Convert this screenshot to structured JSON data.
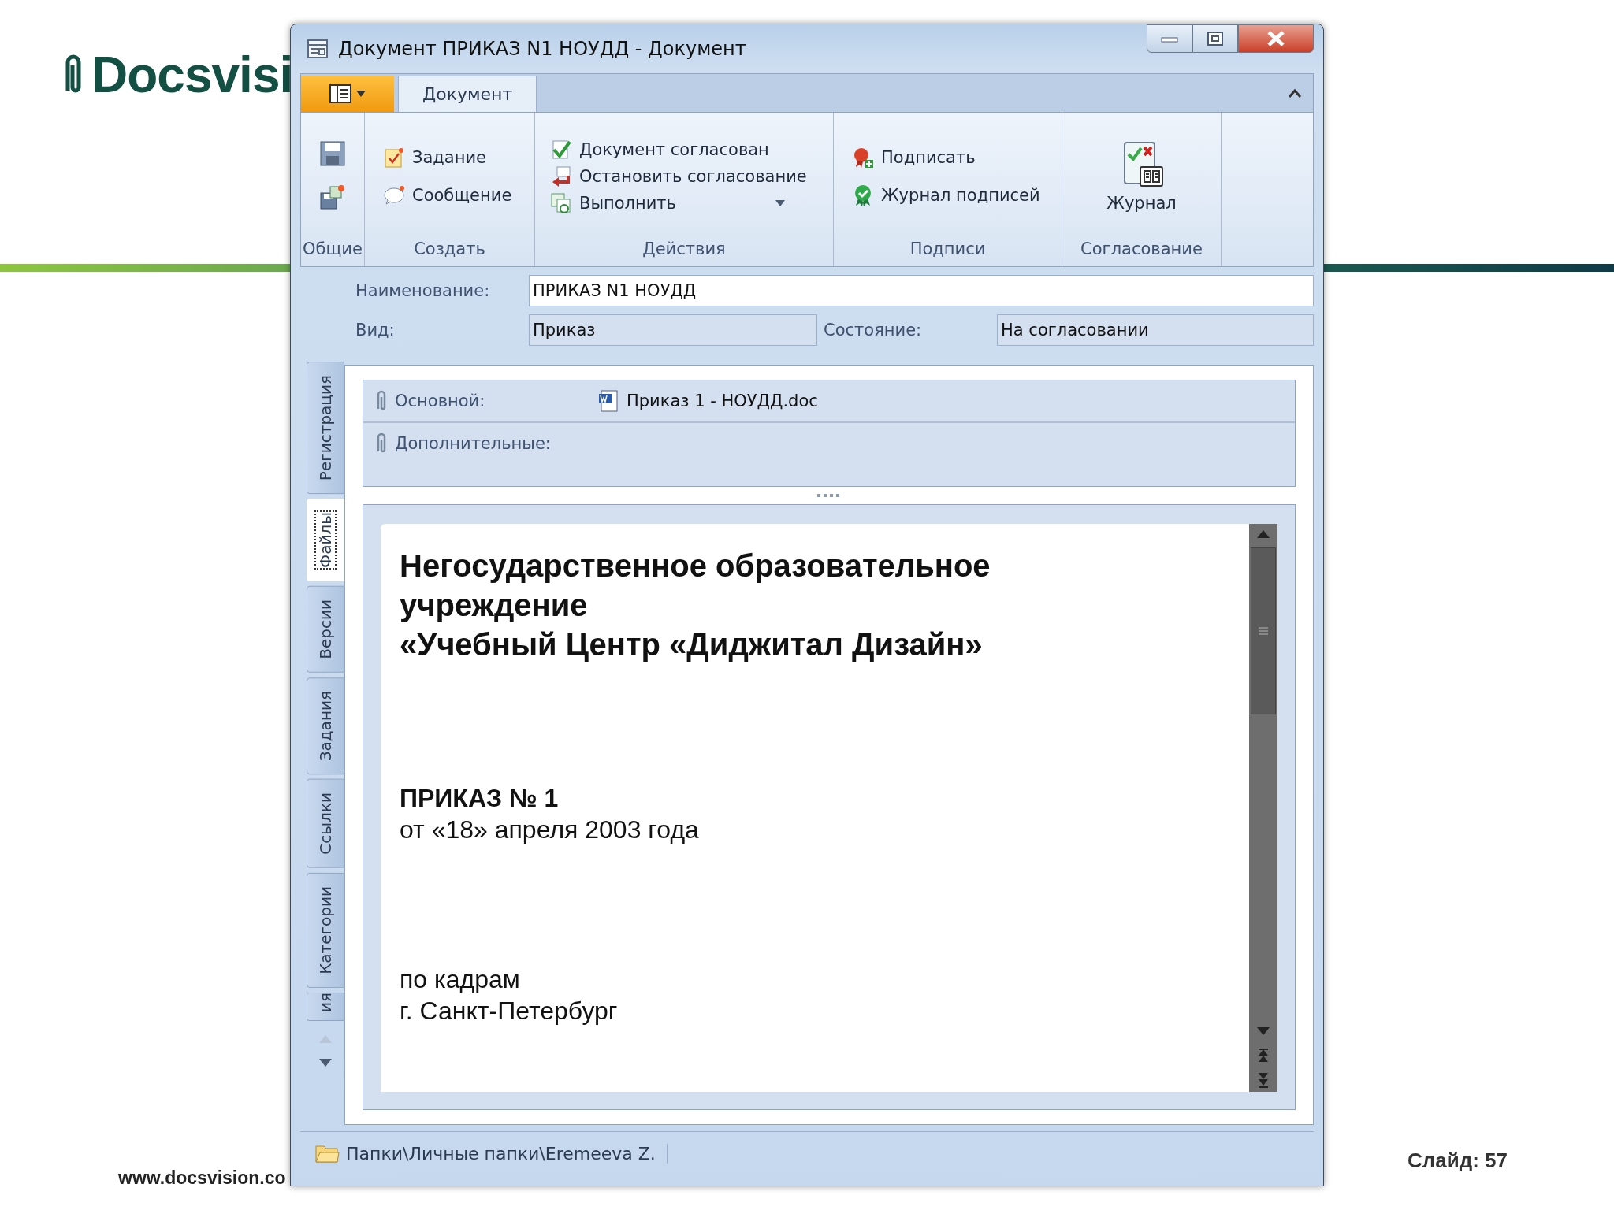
{
  "slide": {
    "logo_text": "Docsvisi",
    "website": "www.docsvision.co",
    "slide_number": "Слайд: 57"
  },
  "window": {
    "title": "Документ ПРИКАЗ N1 НОУДД - Документ"
  },
  "ribbon": {
    "tabs": [
      {
        "label": "Документ",
        "selected": true
      }
    ],
    "groups": [
      {
        "label": "Общие"
      },
      {
        "label": "Создать",
        "items": [
          {
            "label": "Задание",
            "kind": "small",
            "dropdown": false
          },
          {
            "label": "Сообщение",
            "kind": "small",
            "dropdown": false
          }
        ]
      },
      {
        "label": "Действия",
        "items": [
          {
            "label": "Документ согласован",
            "kind": "compact",
            "dropdown": false
          },
          {
            "label": "Остановить согласование",
            "kind": "compact",
            "dropdown": false
          },
          {
            "label": "Выполнить",
            "kind": "compact",
            "dropdown": true
          }
        ]
      },
      {
        "label": "Подписи",
        "items": [
          {
            "label": "Подписать",
            "kind": "small",
            "dropdown": false
          },
          {
            "label": "Журнал подписей",
            "kind": "small",
            "dropdown": false
          }
        ]
      },
      {
        "label": "Согласование",
        "items": [
          {
            "label": "Журнал",
            "kind": "large",
            "dropdown": false
          }
        ]
      }
    ]
  },
  "fields": [
    {
      "label": "Наименование:",
      "value": "ПРИКАЗ N1 НОУДД",
      "readonly": false
    },
    {
      "label": "Вид:",
      "value": "Приказ",
      "readonly": true
    },
    {
      "label": "Состояние:",
      "value": "На согласовании",
      "readonly": true
    }
  ],
  "side_tabs": [
    {
      "label": "Регистрация",
      "selected": false
    },
    {
      "label": "Файлы",
      "selected": true
    },
    {
      "label": "Версии",
      "selected": false
    },
    {
      "label": "Задания",
      "selected": false
    },
    {
      "label": "Ссылки",
      "selected": false
    },
    {
      "label": "Категории",
      "selected": false
    },
    {
      "label": "ия",
      "selected": false
    }
  ],
  "attachments": [
    {
      "label": "Основной:",
      "file": "Приказ 1 - НОУДД.doc"
    },
    {
      "label": "Дополнительные:"
    }
  ],
  "document": [
    {
      "kind": "heading",
      "text": "Негосударственное образовательное учреждение"
    },
    {
      "kind": "heading",
      "text": "«Учебный Центр «Диджитал Дизайн»"
    },
    {
      "kind": "gap"
    },
    {
      "kind": "title",
      "text": "ПРИКАЗ № 1"
    },
    {
      "kind": "text",
      "text": "от «18» апреля 2003 года"
    },
    {
      "kind": "gap"
    },
    {
      "kind": "text",
      "text": "по кадрам"
    },
    {
      "kind": "text",
      "text": "г. Санкт-Петербург"
    }
  ],
  "status_bar": {
    "path": "Папки\\Личные папки\\Eremeeva Z."
  }
}
